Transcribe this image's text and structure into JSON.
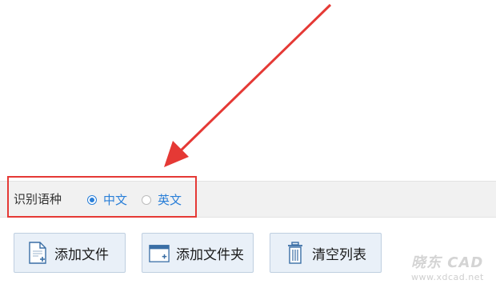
{
  "language_section": {
    "label": "识别语种",
    "options": [
      {
        "label": "中文",
        "selected": true
      },
      {
        "label": "英文",
        "selected": false
      }
    ]
  },
  "buttons": {
    "add_file": "添加文件",
    "add_folder": "添加文件夹",
    "clear_list": "清空列表"
  },
  "watermark": {
    "main": "晓东 CAD",
    "sub": "www.xdcad.net"
  },
  "colors": {
    "accent": "#2a7fd8",
    "annotation_red": "#e53935",
    "button_bg": "#e9f0f8"
  }
}
